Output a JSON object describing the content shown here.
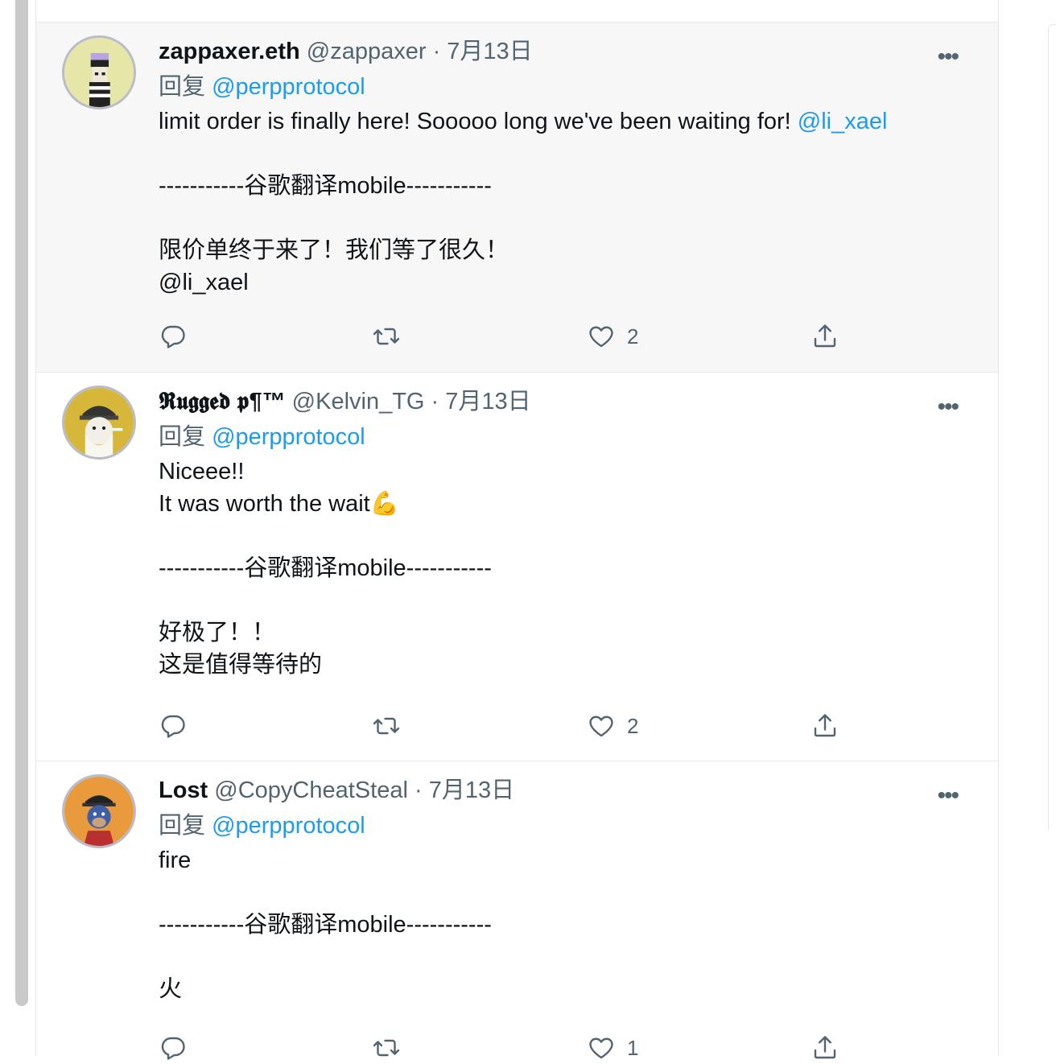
{
  "tweets": [
    {
      "display_name": "zappaxer.eth",
      "handle": "@zappaxer",
      "separator": "·",
      "date": "7月13日",
      "reply_prefix": "回复",
      "reply_to": "@perpprotocol",
      "text_before_mention": "limit order is finally here! Sooooo long we've been waiting for! ",
      "text_mention": "@li_xael",
      "divider": "-----------谷歌翻译mobile-----------",
      "translation_line1": "限价单终于来了！我们等了很久！",
      "translation_line2": "@li_xael",
      "like_count": "2",
      "avatar_color": "#e6e6a8"
    },
    {
      "display_name": "𝕽𝖚𝖌𝖌𝖊𝖉 𝖕¶™",
      "handle": "@Kelvin_TG",
      "separator": "·",
      "date": "7月13日",
      "reply_prefix": "回复",
      "reply_to": "@perpprotocol",
      "line1": "Niceee!!",
      "line2": "It was worth the wait💪",
      "divider": "-----------谷歌翻译mobile-----------",
      "translation_line1": "好极了！！",
      "translation_line2": "这是值得等待的",
      "like_count": "2",
      "avatar_color": "#d6b73a"
    },
    {
      "display_name": "Lost",
      "handle": "@CopyCheatSteal",
      "separator": "·",
      "date": "7月13日",
      "reply_prefix": "回复",
      "reply_to": "@perpprotocol",
      "line1": "fire",
      "divider": "-----------谷歌翻译mobile-----------",
      "translation_line1": "火",
      "like_count": "1",
      "avatar_color": "#e89a3c"
    }
  ],
  "icons": {
    "more": "•••",
    "reply": "reply-icon",
    "retweet": "retweet-icon",
    "like": "heart-icon",
    "share": "share-icon"
  },
  "colors": {
    "link": "#1d9bf0",
    "muted": "#536471",
    "highlight_bg": "#f7f7f7"
  }
}
